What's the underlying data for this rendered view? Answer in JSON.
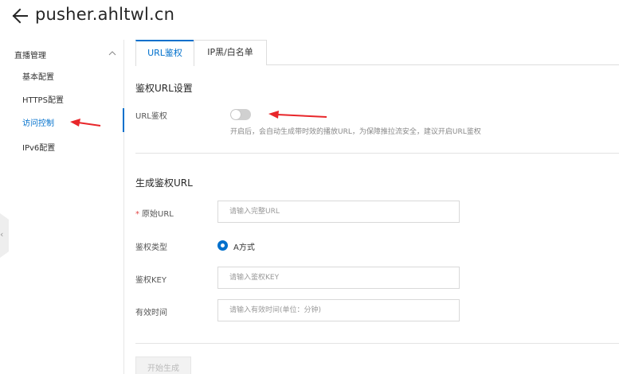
{
  "header": {
    "title": "pusher.ahltwl.cn",
    "back_icon": "arrow-left-icon"
  },
  "sidebar": {
    "group_label": "直播管理",
    "items": [
      {
        "label": "基本配置",
        "active": false
      },
      {
        "label": "HTTPS配置",
        "active": false
      },
      {
        "label": "访问控制",
        "active": true
      },
      {
        "label": "IPv6配置",
        "active": false
      }
    ]
  },
  "tabs": [
    {
      "label": "URL鉴权",
      "active": true
    },
    {
      "label": "IP黑/白名单",
      "active": false
    }
  ],
  "auth_settings": {
    "title": "鉴权URL设置",
    "toggle_label": "URL鉴权",
    "toggle_on": false,
    "hint": "开启后，会自动生成带时效的播放URL，为保障推拉流安全，建议开启URL鉴权"
  },
  "generate": {
    "title": "生成鉴权URL",
    "original_url": {
      "label": "原始URL",
      "required": "*",
      "placeholder": "请输入完整URL",
      "value": ""
    },
    "auth_type": {
      "label": "鉴权类型",
      "option": "A方式",
      "selected": true
    },
    "auth_key": {
      "label": "鉴权KEY",
      "placeholder": "请输入鉴权KEY",
      "value": ""
    },
    "valid_time": {
      "label": "有效时间",
      "placeholder": "请输入有效时间(单位：分钟)",
      "value": ""
    },
    "button_label": "开始生成"
  },
  "colors": {
    "accent": "#0070cc",
    "annotation_arrow": "#e8262a",
    "required": "#e24545"
  }
}
